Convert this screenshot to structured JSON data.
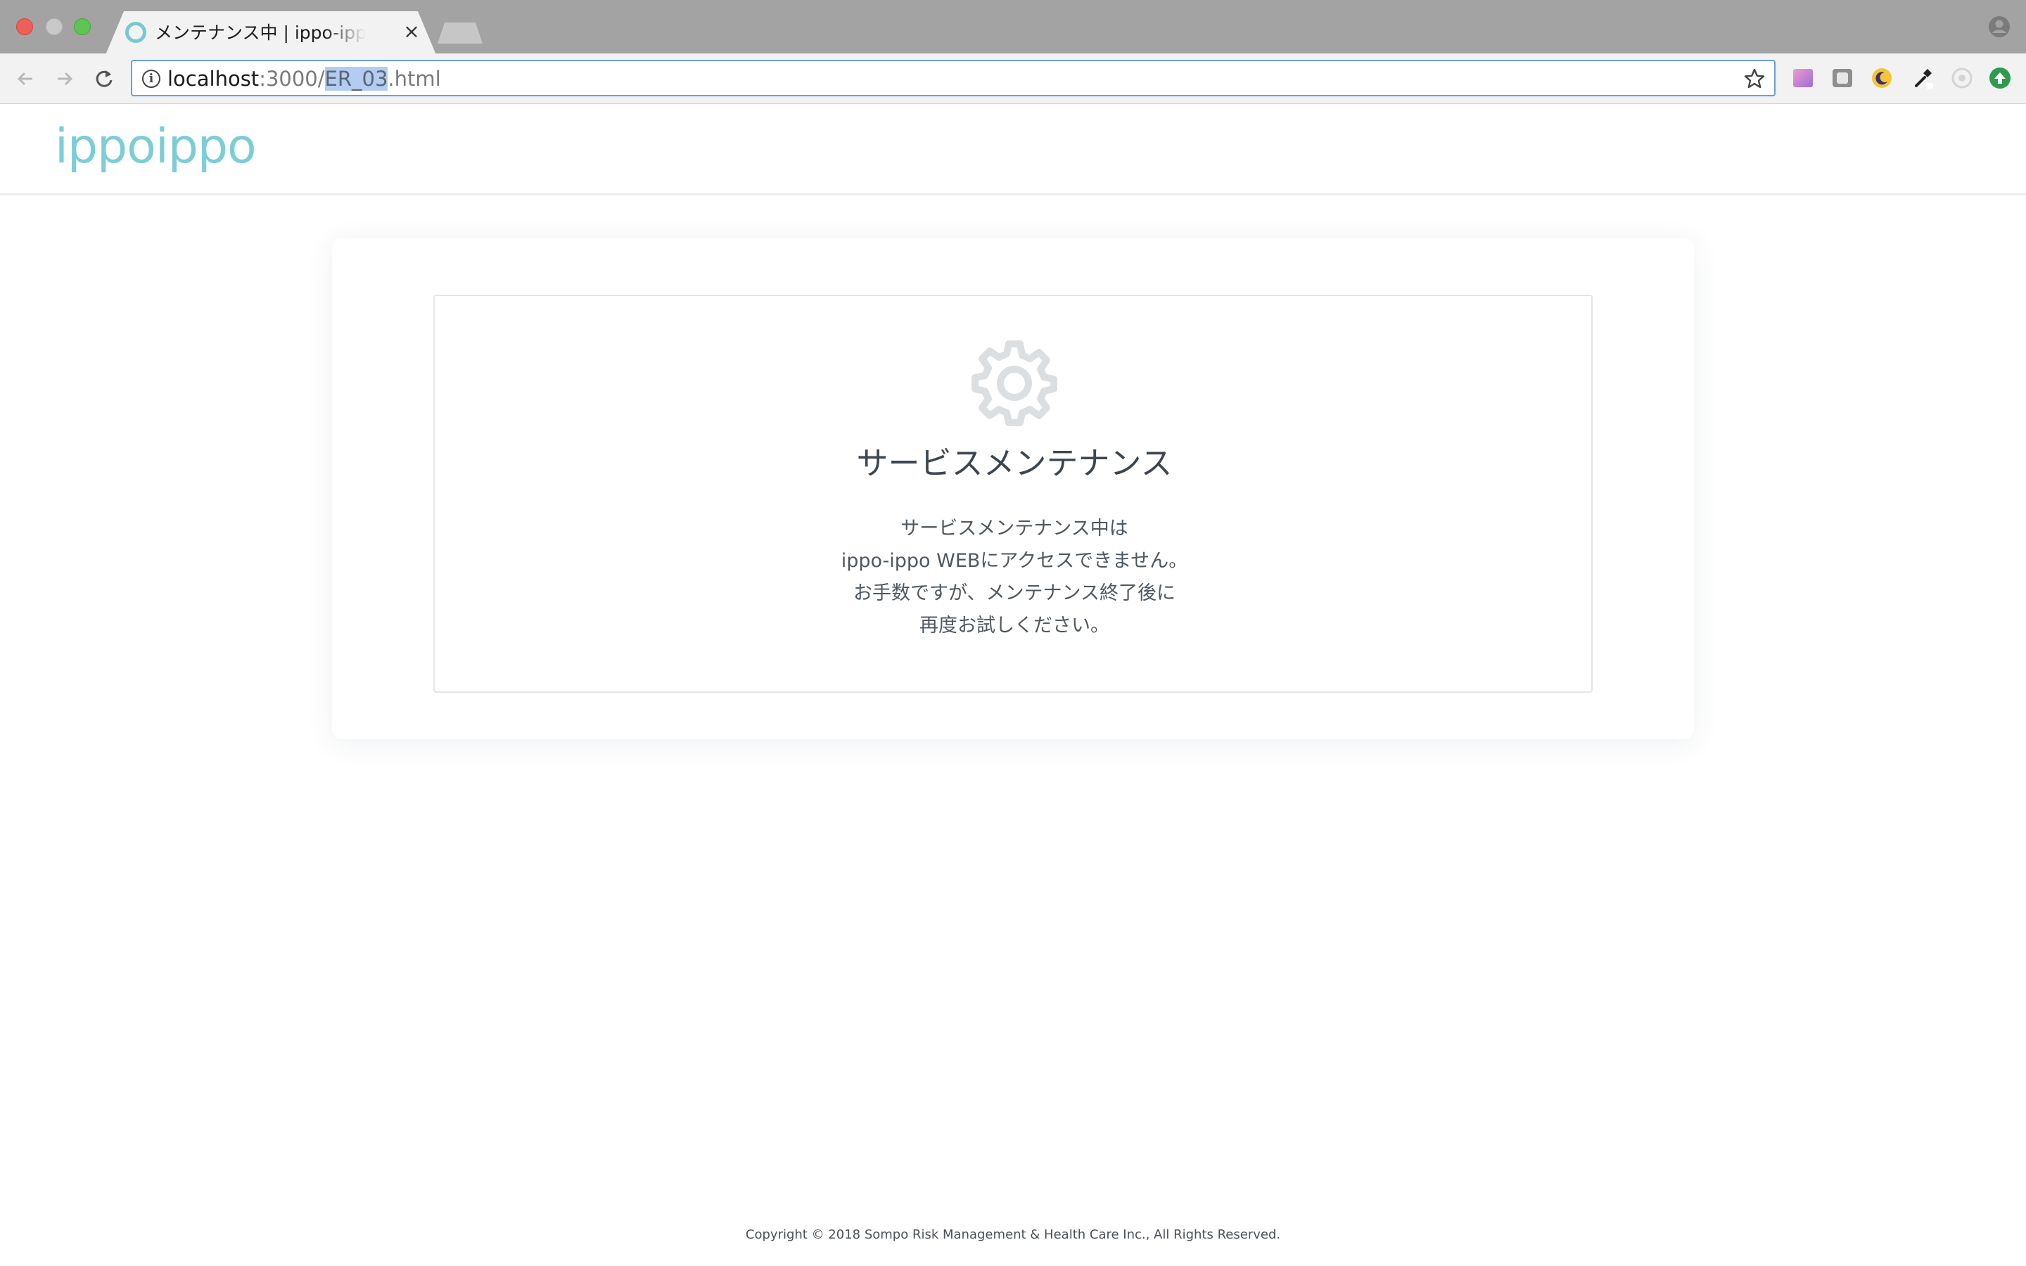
{
  "browser": {
    "tab_title": "メンテナンス中 | ippo-ippo WEB",
    "tab_close_glyph": "×",
    "url": {
      "host": "localhost",
      "port_path": ":3000/",
      "selected": "ER_03",
      "rest": ".html"
    },
    "icons": {
      "back": "back-arrow-icon",
      "forward": "forward-arrow-icon",
      "reload": "reload-icon",
      "info": "info-icon",
      "star": "star-icon",
      "profile": "profile-icon"
    },
    "colors": {
      "accent_border": "#6a9fe0",
      "selection": "#b2cdf1"
    }
  },
  "site": {
    "logo_text": "ippoippo",
    "brand_color": "#7dcdd6"
  },
  "maintenance": {
    "icon": "gear-icon",
    "heading": "サービスメンテナンス",
    "lines": [
      "サービスメンテナンス中は",
      "ippo-ippo WEBにアクセスできません。",
      "お手数ですが、メンテナンス終了後に",
      "再度お試しください。"
    ]
  },
  "footer": {
    "copyright": "Copyright © 2018 Sompo Risk Management & Health Care Inc., All Rights Reserved."
  }
}
